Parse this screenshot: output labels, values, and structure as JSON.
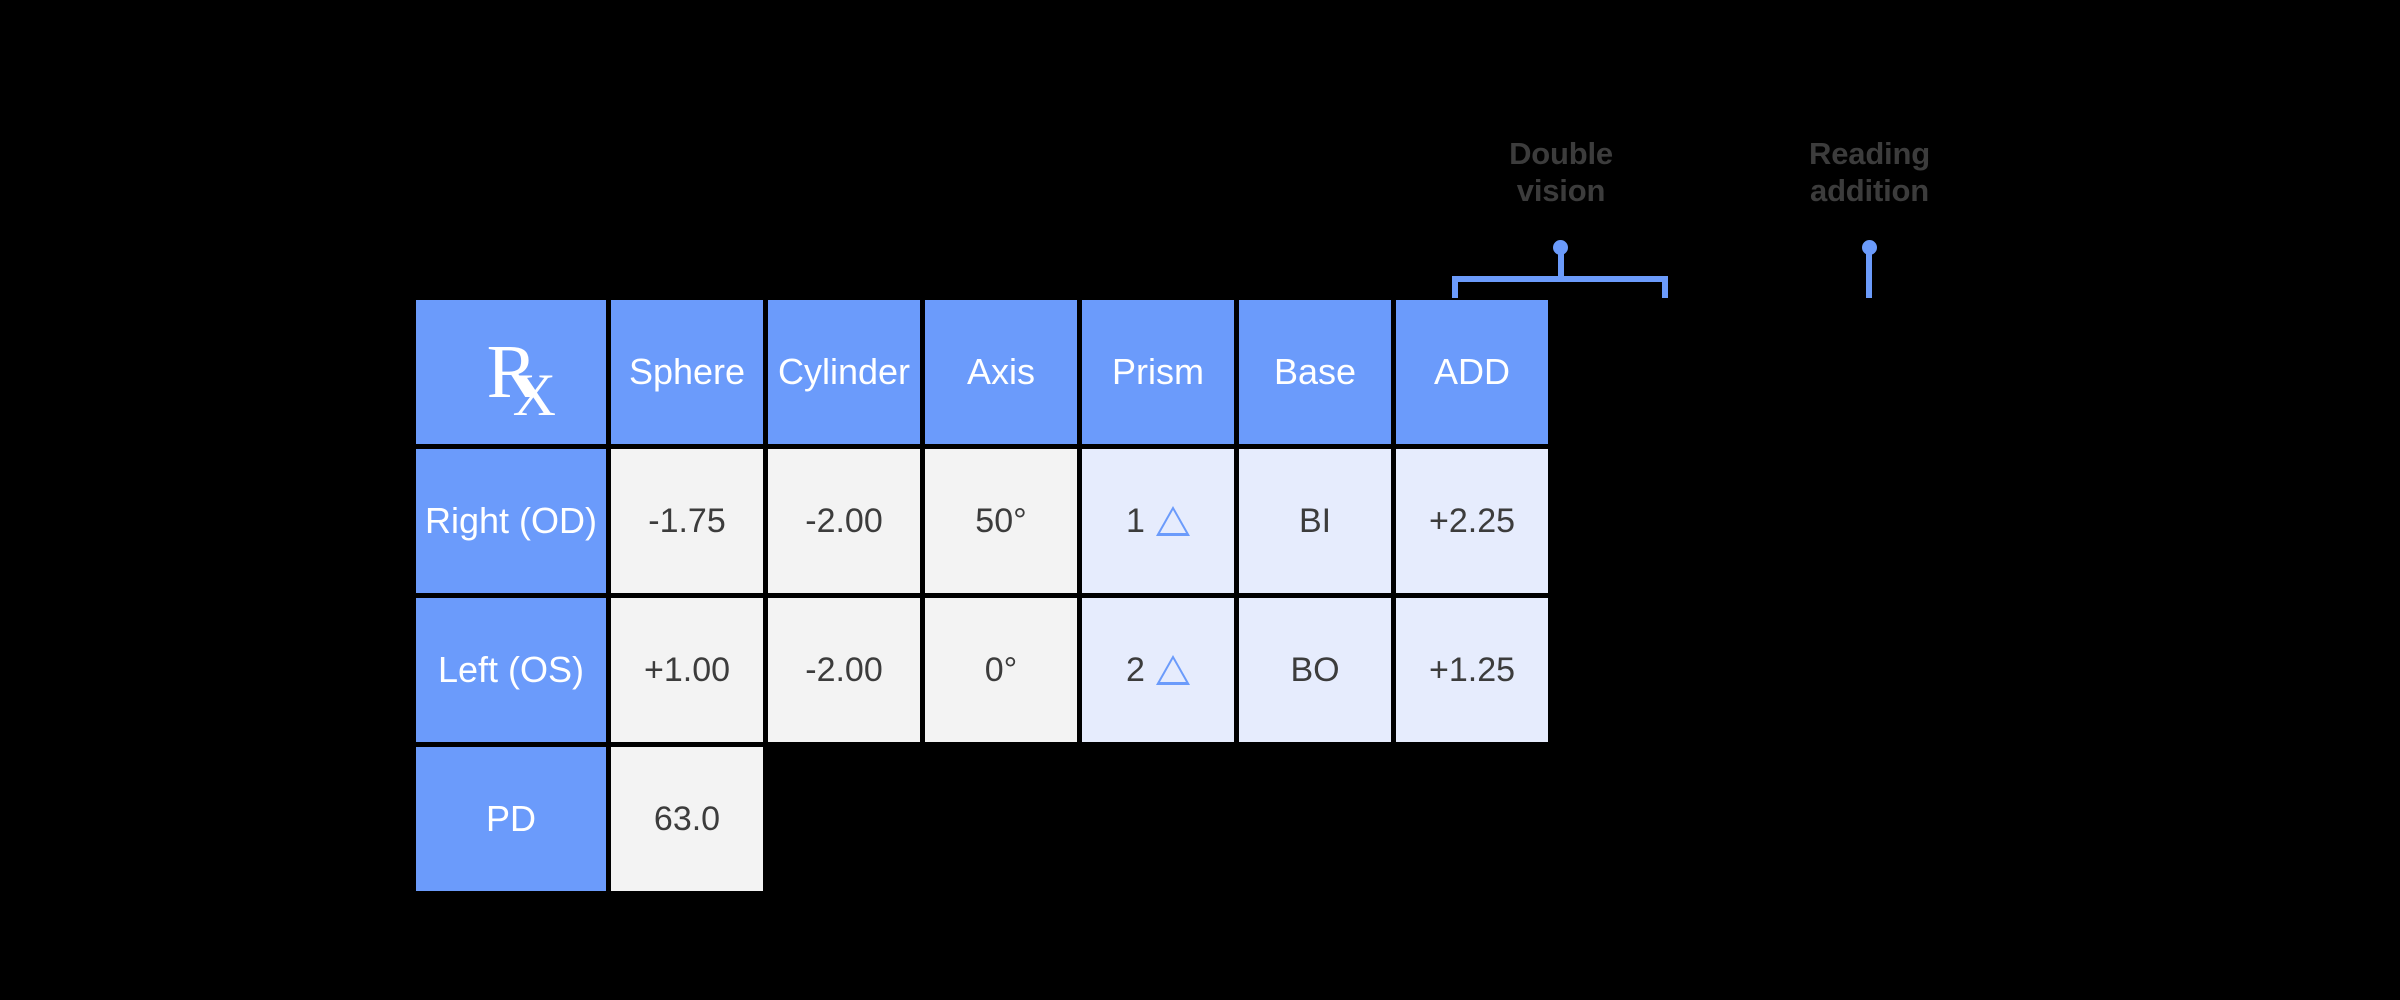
{
  "annotations": [
    {
      "id": "double-vision",
      "label": "Double\nvision",
      "type": "bracket",
      "target_columns": [
        "Prism",
        "Base"
      ]
    },
    {
      "id": "reading-addition",
      "label": "Reading\naddition",
      "type": "pin",
      "target_columns": [
        "ADD"
      ]
    }
  ],
  "table": {
    "symbol": {
      "r": "R",
      "x": "X",
      "name": "Rx"
    },
    "columns": [
      "Rx",
      "Sphere",
      "Cylinder",
      "Axis",
      "Prism",
      "Base",
      "ADD"
    ],
    "headers": {
      "sphere": "Sphere",
      "cylinder": "Cylinder",
      "axis": "Axis",
      "prism": "Prism",
      "base": "Base",
      "add": "ADD"
    },
    "rows": [
      {
        "label": "Right (OD)",
        "sphere": "-1.75",
        "cylinder": "-2.00",
        "axis": "50°",
        "prism": "1",
        "prism_unit": "prism-diopter-triangle",
        "base": "BI",
        "add": "+2.25"
      },
      {
        "label": "Left (OS)",
        "sphere": "+1.00",
        "cylinder": "-2.00",
        "axis": "0°",
        "prism": "2",
        "prism_unit": "prism-diopter-triangle",
        "base": "BO",
        "add": "+1.25"
      }
    ],
    "pd_row": {
      "label": "PD",
      "value": "63.0"
    }
  },
  "colors": {
    "background": "#000000",
    "accent_blue": "#6b9bfb",
    "cell_gray": "#f3f3f3",
    "cell_highlight": "#e6ecfd",
    "header_text": "#ffffff",
    "value_text": "#3c3c3c",
    "annotation_text": "#3c3c3c"
  }
}
